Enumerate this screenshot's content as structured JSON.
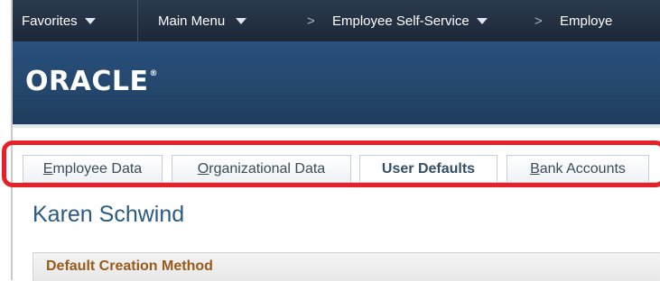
{
  "nav": {
    "favorites": "Favorites",
    "main_menu": "Main Menu",
    "sep1": ">",
    "employee_self_service": "Employee Self-Service",
    "sep2": ">",
    "current": "Employe"
  },
  "brand": {
    "logo": "ORACLE",
    "logo_mark": "®"
  },
  "tabs": [
    {
      "label_first": "E",
      "label_rest": "mployee Data",
      "active": false
    },
    {
      "label_first": "O",
      "label_rest": "rganizational Data",
      "active": false
    },
    {
      "label_first": "",
      "label_rest": "User Defaults",
      "active": true
    },
    {
      "label_first": "B",
      "label_rest": "ank Accounts",
      "active": false
    }
  ],
  "person": {
    "name": "Karen Schwind"
  },
  "section": {
    "header": "Default Creation Method"
  },
  "colors": {
    "highlight": "#e8202a",
    "nav_bg": "#1c2838",
    "brand_bg": "#24466b",
    "section_title": "#9a5a1a"
  }
}
